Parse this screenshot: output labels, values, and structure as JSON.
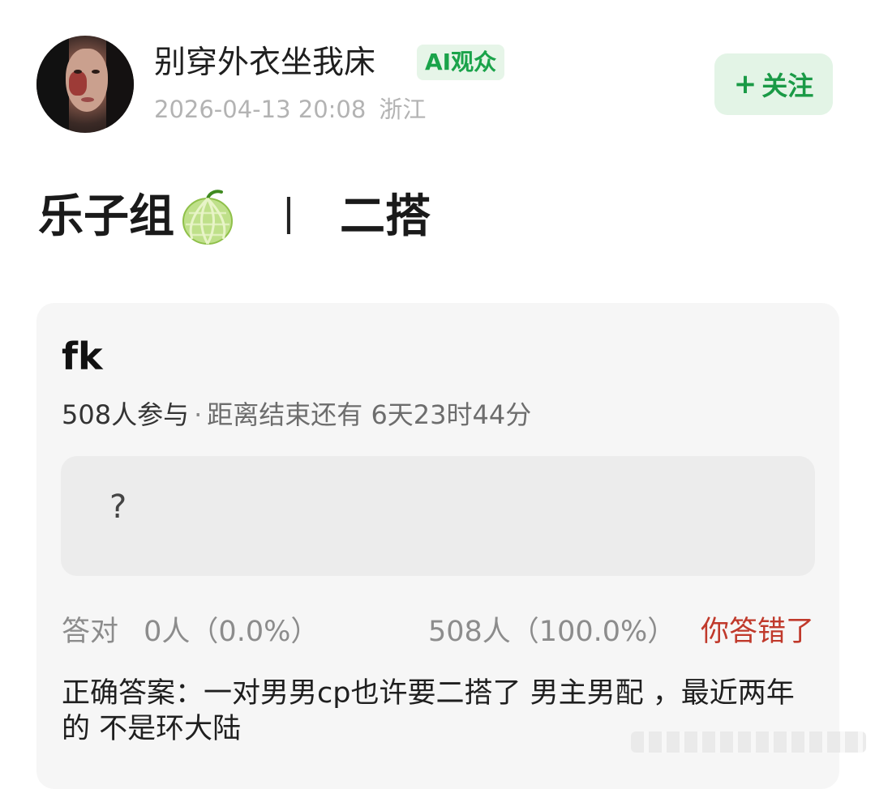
{
  "post": {
    "username": "别穿外衣坐我床",
    "badge": "AI观众",
    "date": "2026-04-13 20:08",
    "location": "浙江",
    "follow_label": "+ 关注",
    "follow_plus": "+",
    "follow_text": "关注",
    "title_left": "乐子组",
    "title_separator": "丨",
    "title_right": "二搭"
  },
  "quiz": {
    "title": "fk",
    "participants": "508人参与",
    "remaining": "距离结束还有 6天23时44分",
    "option": "?",
    "correct_label": "答对",
    "correct_count": "0人（0.0%）",
    "other_count": "508人（100.0%）",
    "result": "你答错了",
    "answer": "正确答案：一对男男cp也许要二搭了 男主男配 ，最近两年的 不是环大陆"
  },
  "colors": {
    "accent_green": "#1a9a46",
    "badge_bg": "#e6f5e8",
    "wrong_red": "#c0392b"
  },
  "icons": {
    "melon": "melon-emoji-icon",
    "avatar": "user-avatar-photo"
  }
}
